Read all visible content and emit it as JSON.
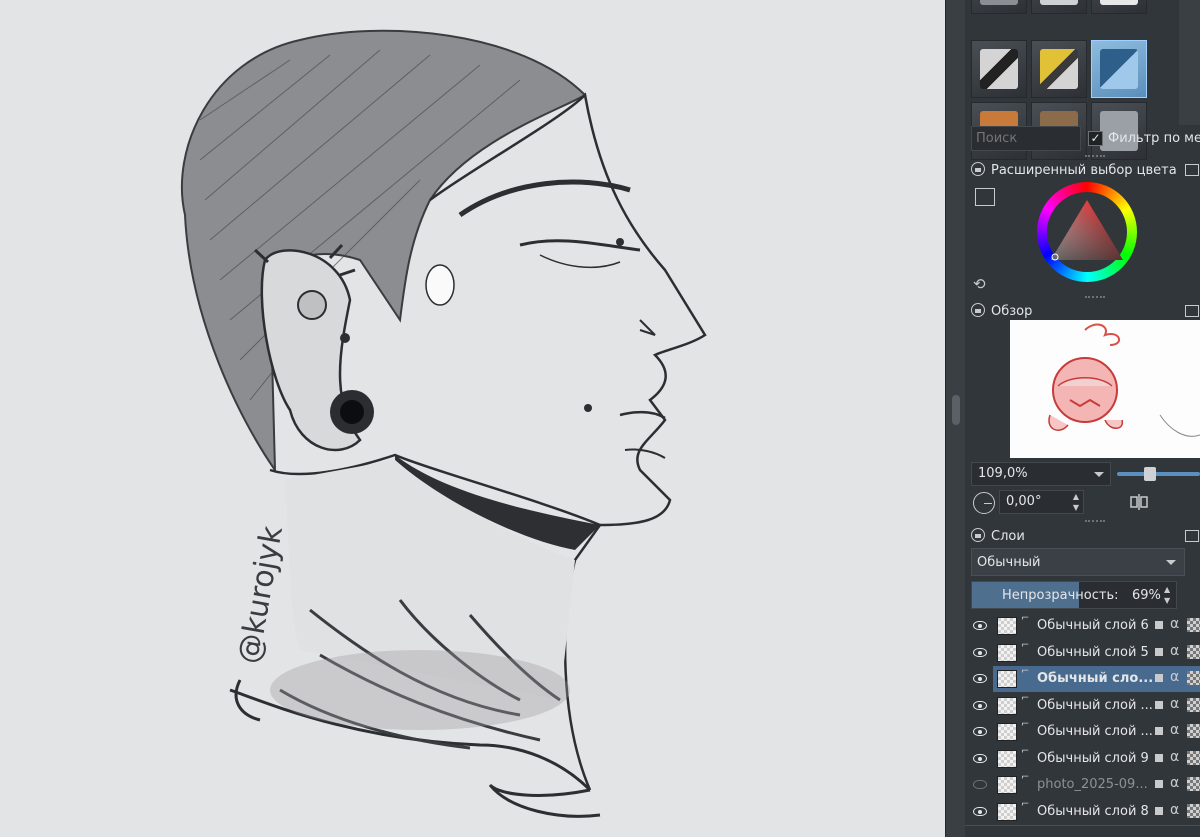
{
  "brush_presets": {
    "search_placeholder": "Поиск",
    "filter_label": "Фильтр по мет",
    "filter_checked": true
  },
  "color_selector": {
    "title": "Расширенный выбор цвета"
  },
  "overview": {
    "title": "Обзор"
  },
  "view": {
    "zoom": "109,0%",
    "rotation": "0,00°"
  },
  "layers": {
    "title": "Слои",
    "blend_mode": "Обычный",
    "opacity_label": "Непрозрачность:",
    "opacity_value": "69%",
    "opacity_fraction": 0.69,
    "items": [
      {
        "name": "Обычный слой 6",
        "visible": true,
        "active": false
      },
      {
        "name": "Обычный слой 5",
        "visible": true,
        "active": false
      },
      {
        "name": "Обычный сло...",
        "visible": true,
        "active": true
      },
      {
        "name": "Обычный слой ...",
        "visible": true,
        "active": false
      },
      {
        "name": "Обычный слой ...",
        "visible": true,
        "active": false
      },
      {
        "name": "Обычный слой 9",
        "visible": true,
        "active": false
      },
      {
        "name": "photo_2025-09...",
        "visible": false,
        "active": false
      },
      {
        "name": "Обычный слой 8",
        "visible": true,
        "active": false
      }
    ]
  },
  "artwork": {
    "signature": "@kurojyk"
  },
  "icons": {
    "lock": "lock-icon",
    "float": "float-window-icon",
    "eye": "eye-icon",
    "alpha": "alpha-lock-icon",
    "mirror": "mirror-icon",
    "reset": "reset-icon"
  }
}
